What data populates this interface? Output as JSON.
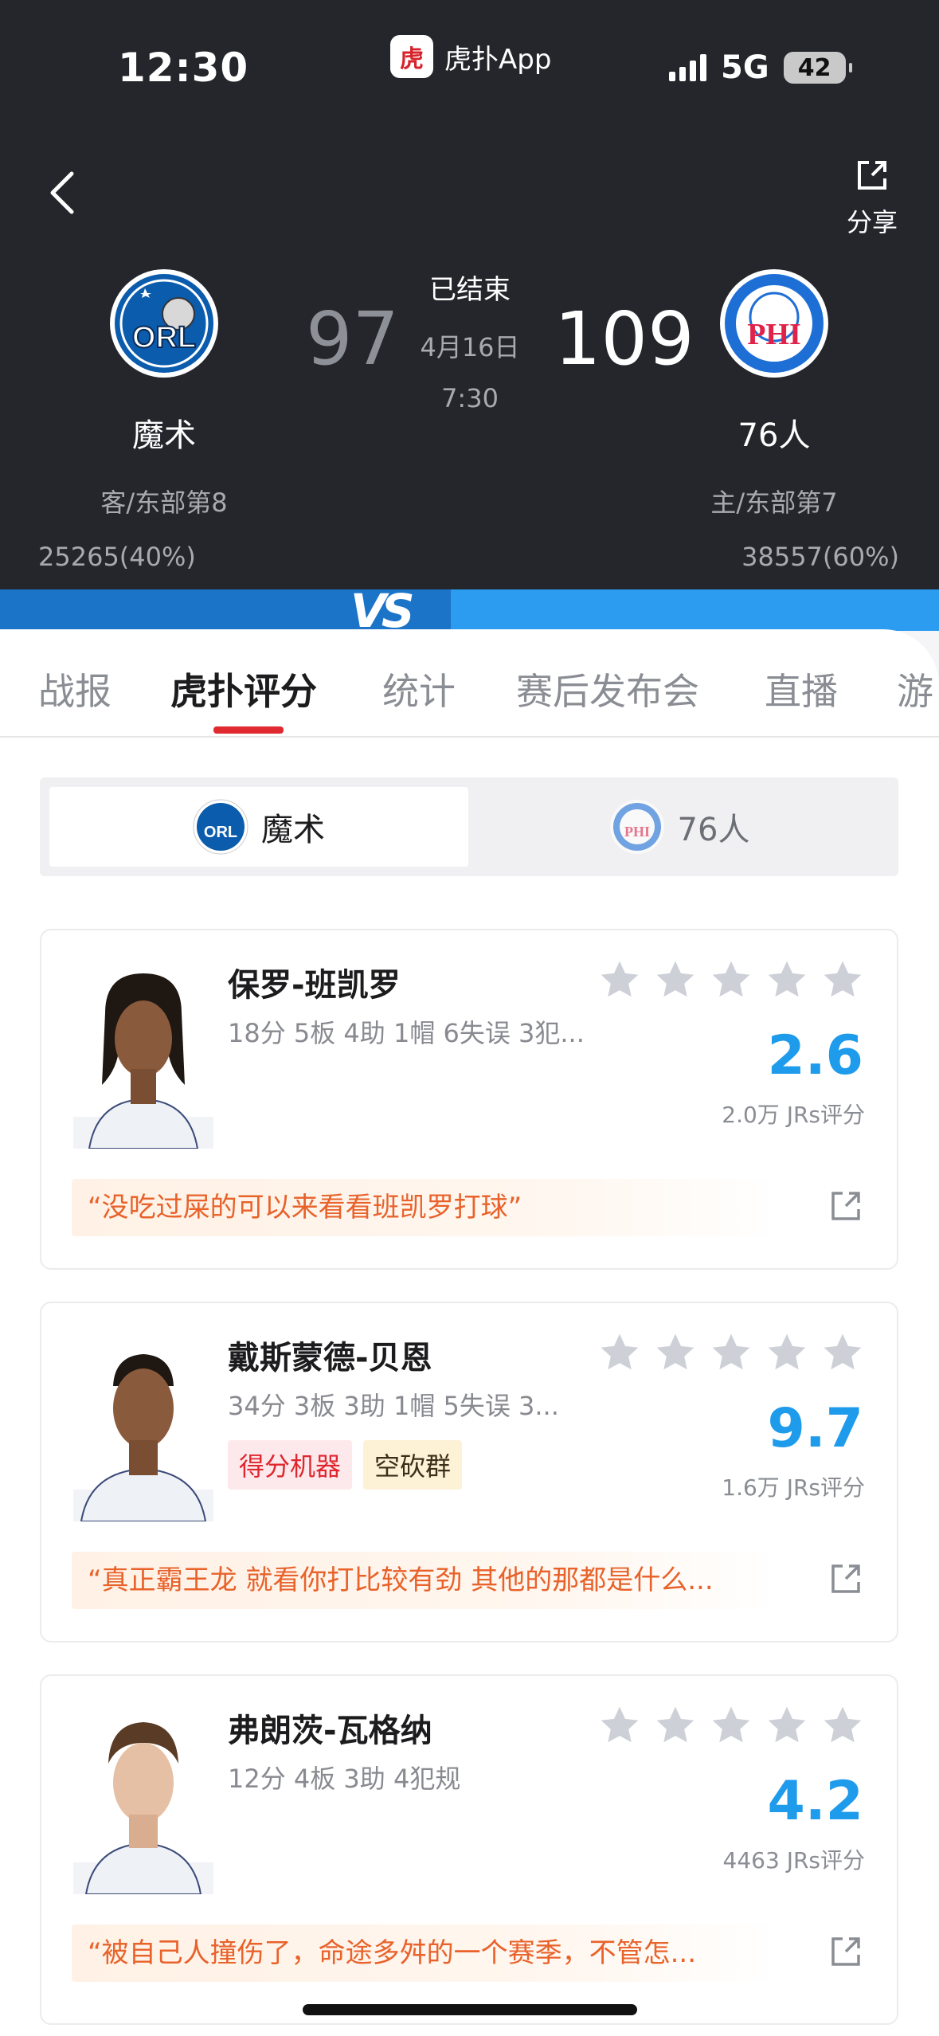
{
  "status_bar": {
    "time": "12:30",
    "app_name": "虎扑App",
    "app_logo_text": "虎扑",
    "network": "5G",
    "battery": "42"
  },
  "header": {
    "share_label": "分享"
  },
  "game": {
    "away": {
      "name": "魔术",
      "sub": "客/东部第8",
      "score": "97",
      "support": "25265(40%)",
      "logo_text": "ORL"
    },
    "home": {
      "name": "76人",
      "sub": "主/东部第7",
      "score": "109",
      "support": "38557(60%)",
      "logo_text": "PHI"
    },
    "status": "已结束",
    "date": "4月16日",
    "time": "7:30"
  },
  "vs_label": "VS",
  "tabs": [
    "战报",
    "虎扑评分",
    "统计",
    "赛后发布会",
    "直播",
    "游"
  ],
  "team_toggle": {
    "active": "魔术",
    "inactive": "76人"
  },
  "players": [
    {
      "name": "保罗-班凯罗",
      "stats": "18分 5板 4助 1帽 6失误 3犯...",
      "tags": [],
      "rating": "2.6",
      "rating_count": "2.0万 JRs评分",
      "quote": "“没吃过屎的可以来看看班凯罗打球”"
    },
    {
      "name": "戴斯蒙德-贝恩",
      "stats": "34分 3板 3助 1帽 5失误 3...",
      "tags": [
        "得分机器",
        "空砍群"
      ],
      "rating": "9.7",
      "rating_count": "1.6万 JRs评分",
      "quote": "“真正霸王龙 就看你打比较有劲 其他的那都是什么..."
    },
    {
      "name": "弗朗茨-瓦格纳",
      "stats": "12分 4板 3助 4犯规",
      "tags": [],
      "rating": "4.2",
      "rating_count": "4463 JRs评分",
      "quote": "“被自己人撞伤了，命途多舛的一个赛季，不管怎..."
    }
  ],
  "colors": {
    "header_bg": "#24262b",
    "accent_red": "#e12a30",
    "rating_blue": "#1f9bec",
    "quote_orange": "#e8622a"
  }
}
